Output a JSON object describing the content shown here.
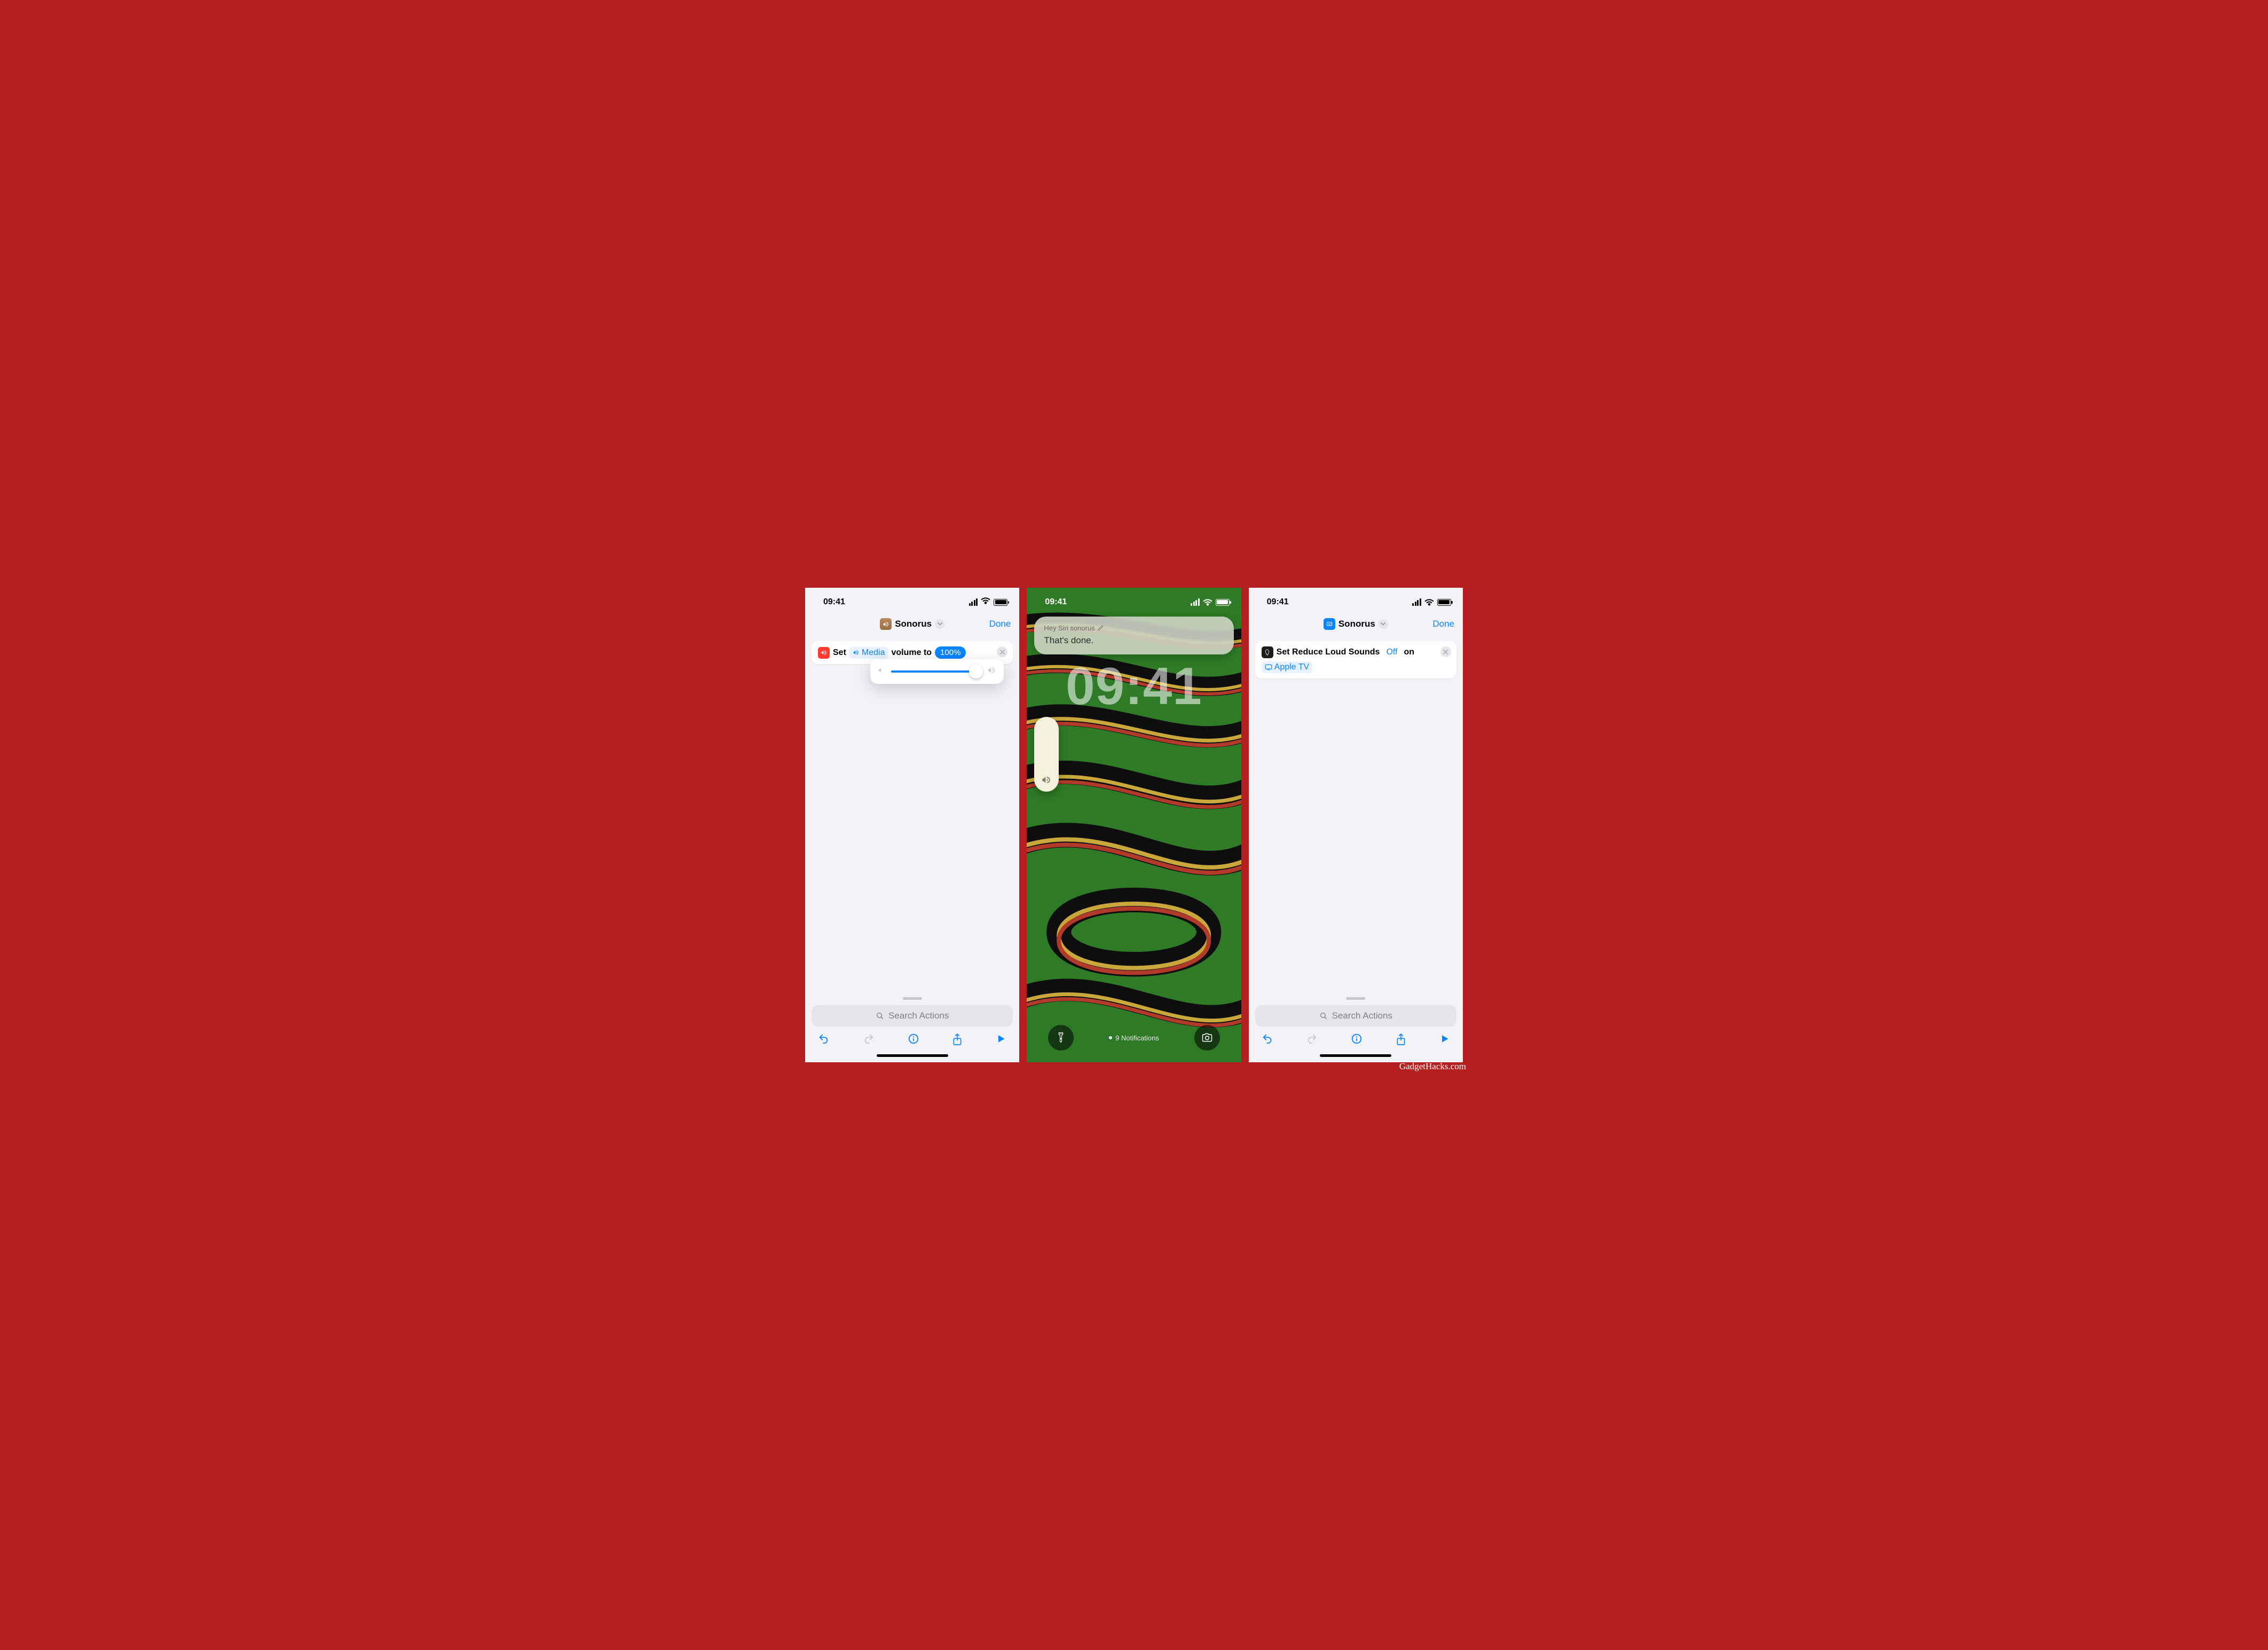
{
  "status": {
    "time": "09:41"
  },
  "attribution": "GadgetHacks.com",
  "left": {
    "title": "Sonorus",
    "done": "Done",
    "action": {
      "set": "Set",
      "media_label": "Media",
      "mid": "volume to",
      "value": "100%"
    },
    "search_placeholder": "Search Actions"
  },
  "right": {
    "title": "Sonorus",
    "done": "Done",
    "action": {
      "text_a": "Set Reduce Loud Sounds",
      "off": "Off",
      "text_b": "on",
      "tv": "Apple TV"
    },
    "search_placeholder": "Search Actions"
  },
  "lock": {
    "siri_line1": "Hey Siri sonorus",
    "siri_line2": "That's done.",
    "big_time": "09:41",
    "notifications": "9 Notifications"
  }
}
